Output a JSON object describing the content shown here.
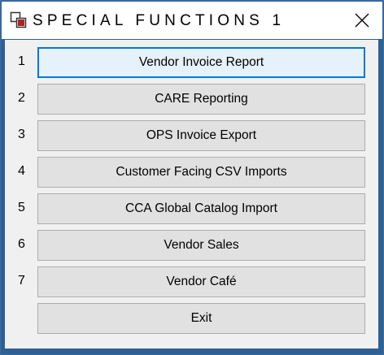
{
  "window": {
    "title": "SPECIAL FUNCTIONS 1",
    "app_icon": "overlapping-squares-icon",
    "close_icon": "close-icon",
    "border_color": "#2f5f93",
    "focus_color": "#0078d7"
  },
  "rows": [
    {
      "number": "1",
      "label": "Vendor Invoice Report",
      "focused": true
    },
    {
      "number": "2",
      "label": "CARE Reporting",
      "focused": false
    },
    {
      "number": "3",
      "label": "OPS Invoice Export",
      "focused": false
    },
    {
      "number": "4",
      "label": "Customer Facing CSV Imports",
      "focused": false
    },
    {
      "number": "5",
      "label": "CCA Global Catalog Import",
      "focused": false
    },
    {
      "number": "6",
      "label": "Vendor Sales",
      "focused": false
    },
    {
      "number": "7",
      "label": "Vendor Café",
      "focused": false
    }
  ],
  "exit_button": {
    "label": "Exit"
  }
}
